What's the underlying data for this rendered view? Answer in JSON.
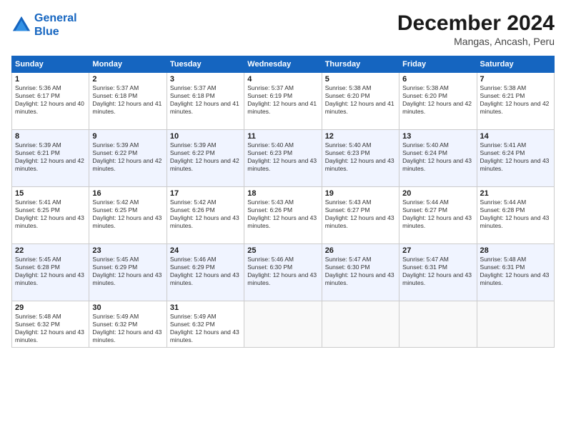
{
  "logo": {
    "line1": "General",
    "line2": "Blue"
  },
  "title": "December 2024",
  "location": "Mangas, Ancash, Peru",
  "weekdays": [
    "Sunday",
    "Monday",
    "Tuesday",
    "Wednesday",
    "Thursday",
    "Friday",
    "Saturday"
  ],
  "weeks": [
    [
      {
        "day": "1",
        "sunrise": "Sunrise: 5:36 AM",
        "sunset": "Sunset: 6:17 PM",
        "daylight": "Daylight: 12 hours and 40 minutes."
      },
      {
        "day": "2",
        "sunrise": "Sunrise: 5:37 AM",
        "sunset": "Sunset: 6:18 PM",
        "daylight": "Daylight: 12 hours and 41 minutes."
      },
      {
        "day": "3",
        "sunrise": "Sunrise: 5:37 AM",
        "sunset": "Sunset: 6:18 PM",
        "daylight": "Daylight: 12 hours and 41 minutes."
      },
      {
        "day": "4",
        "sunrise": "Sunrise: 5:37 AM",
        "sunset": "Sunset: 6:19 PM",
        "daylight": "Daylight: 12 hours and 41 minutes."
      },
      {
        "day": "5",
        "sunrise": "Sunrise: 5:38 AM",
        "sunset": "Sunset: 6:20 PM",
        "daylight": "Daylight: 12 hours and 41 minutes."
      },
      {
        "day": "6",
        "sunrise": "Sunrise: 5:38 AM",
        "sunset": "Sunset: 6:20 PM",
        "daylight": "Daylight: 12 hours and 42 minutes."
      },
      {
        "day": "7",
        "sunrise": "Sunrise: 5:38 AM",
        "sunset": "Sunset: 6:21 PM",
        "daylight": "Daylight: 12 hours and 42 minutes."
      }
    ],
    [
      {
        "day": "8",
        "sunrise": "Sunrise: 5:39 AM",
        "sunset": "Sunset: 6:21 PM",
        "daylight": "Daylight: 12 hours and 42 minutes."
      },
      {
        "day": "9",
        "sunrise": "Sunrise: 5:39 AM",
        "sunset": "Sunset: 6:22 PM",
        "daylight": "Daylight: 12 hours and 42 minutes."
      },
      {
        "day": "10",
        "sunrise": "Sunrise: 5:39 AM",
        "sunset": "Sunset: 6:22 PM",
        "daylight": "Daylight: 12 hours and 42 minutes."
      },
      {
        "day": "11",
        "sunrise": "Sunrise: 5:40 AM",
        "sunset": "Sunset: 6:23 PM",
        "daylight": "Daylight: 12 hours and 43 minutes."
      },
      {
        "day": "12",
        "sunrise": "Sunrise: 5:40 AM",
        "sunset": "Sunset: 6:23 PM",
        "daylight": "Daylight: 12 hours and 43 minutes."
      },
      {
        "day": "13",
        "sunrise": "Sunrise: 5:40 AM",
        "sunset": "Sunset: 6:24 PM",
        "daylight": "Daylight: 12 hours and 43 minutes."
      },
      {
        "day": "14",
        "sunrise": "Sunrise: 5:41 AM",
        "sunset": "Sunset: 6:24 PM",
        "daylight": "Daylight: 12 hours and 43 minutes."
      }
    ],
    [
      {
        "day": "15",
        "sunrise": "Sunrise: 5:41 AM",
        "sunset": "Sunset: 6:25 PM",
        "daylight": "Daylight: 12 hours and 43 minutes."
      },
      {
        "day": "16",
        "sunrise": "Sunrise: 5:42 AM",
        "sunset": "Sunset: 6:25 PM",
        "daylight": "Daylight: 12 hours and 43 minutes."
      },
      {
        "day": "17",
        "sunrise": "Sunrise: 5:42 AM",
        "sunset": "Sunset: 6:26 PM",
        "daylight": "Daylight: 12 hours and 43 minutes."
      },
      {
        "day": "18",
        "sunrise": "Sunrise: 5:43 AM",
        "sunset": "Sunset: 6:26 PM",
        "daylight": "Daylight: 12 hours and 43 minutes."
      },
      {
        "day": "19",
        "sunrise": "Sunrise: 5:43 AM",
        "sunset": "Sunset: 6:27 PM",
        "daylight": "Daylight: 12 hours and 43 minutes."
      },
      {
        "day": "20",
        "sunrise": "Sunrise: 5:44 AM",
        "sunset": "Sunset: 6:27 PM",
        "daylight": "Daylight: 12 hours and 43 minutes."
      },
      {
        "day": "21",
        "sunrise": "Sunrise: 5:44 AM",
        "sunset": "Sunset: 6:28 PM",
        "daylight": "Daylight: 12 hours and 43 minutes."
      }
    ],
    [
      {
        "day": "22",
        "sunrise": "Sunrise: 5:45 AM",
        "sunset": "Sunset: 6:28 PM",
        "daylight": "Daylight: 12 hours and 43 minutes."
      },
      {
        "day": "23",
        "sunrise": "Sunrise: 5:45 AM",
        "sunset": "Sunset: 6:29 PM",
        "daylight": "Daylight: 12 hours and 43 minutes."
      },
      {
        "day": "24",
        "sunrise": "Sunrise: 5:46 AM",
        "sunset": "Sunset: 6:29 PM",
        "daylight": "Daylight: 12 hours and 43 minutes."
      },
      {
        "day": "25",
        "sunrise": "Sunrise: 5:46 AM",
        "sunset": "Sunset: 6:30 PM",
        "daylight": "Daylight: 12 hours and 43 minutes."
      },
      {
        "day": "26",
        "sunrise": "Sunrise: 5:47 AM",
        "sunset": "Sunset: 6:30 PM",
        "daylight": "Daylight: 12 hours and 43 minutes."
      },
      {
        "day": "27",
        "sunrise": "Sunrise: 5:47 AM",
        "sunset": "Sunset: 6:31 PM",
        "daylight": "Daylight: 12 hours and 43 minutes."
      },
      {
        "day": "28",
        "sunrise": "Sunrise: 5:48 AM",
        "sunset": "Sunset: 6:31 PM",
        "daylight": "Daylight: 12 hours and 43 minutes."
      }
    ],
    [
      {
        "day": "29",
        "sunrise": "Sunrise: 5:48 AM",
        "sunset": "Sunset: 6:32 PM",
        "daylight": "Daylight: 12 hours and 43 minutes."
      },
      {
        "day": "30",
        "sunrise": "Sunrise: 5:49 AM",
        "sunset": "Sunset: 6:32 PM",
        "daylight": "Daylight: 12 hours and 43 minutes."
      },
      {
        "day": "31",
        "sunrise": "Sunrise: 5:49 AM",
        "sunset": "Sunset: 6:32 PM",
        "daylight": "Daylight: 12 hours and 43 minutes."
      },
      null,
      null,
      null,
      null
    ]
  ]
}
